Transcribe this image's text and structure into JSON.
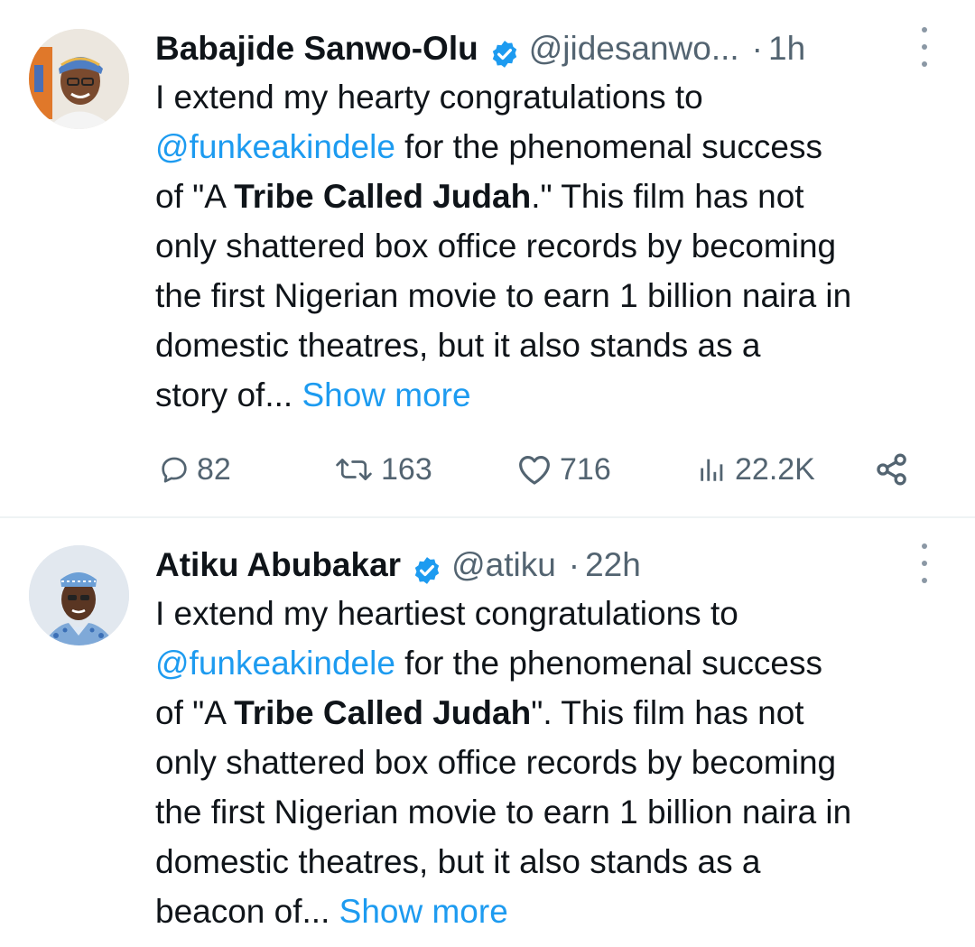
{
  "tweets": [
    {
      "author_name": "Babajide Sanwo-Olu",
      "handle": "@jidesanwo...",
      "separator": "·",
      "time": "1h",
      "lines": [
        [
          "I extend my hearty congratulations to"
        ],
        [
          "@funkeakindele",
          " for the phenomenal success"
        ],
        [
          "of \"A ",
          "Tribe Called Judah",
          ".\" This film has not"
        ],
        [
          "only shattered box office records by becoming"
        ],
        [
          "the first Nigerian movie to earn 1 billion naira in"
        ],
        [
          "domestic theatres, but it also stands as a"
        ],
        [
          "story of... ",
          "Show more"
        ]
      ],
      "stats": {
        "replies": "82",
        "retweets": "163",
        "likes": "716",
        "views": "22.2K"
      }
    },
    {
      "author_name": "Atiku Abubakar",
      "handle": "@atiku",
      "separator": "·",
      "time": "22h",
      "lines": [
        [
          "I extend my heartiest congratulations to"
        ],
        [
          "@funkeakindele",
          " for the phenomenal success"
        ],
        [
          "of \"A ",
          "Tribe Called Judah",
          "\". This film has not"
        ],
        [
          "only shattered box office records by becoming"
        ],
        [
          "the first Nigerian movie to earn 1 billion naira in"
        ],
        [
          "domestic theatres, but it also stands as a"
        ],
        [
          "beacon of... ",
          "Show more"
        ]
      ]
    }
  ],
  "icons": {
    "verified": "verified-badge-icon",
    "more": "more-options-icon",
    "reply": "reply-icon",
    "retweet": "retweet-icon",
    "like": "heart-icon",
    "views": "views-icon",
    "share": "share-icon"
  },
  "colors": {
    "link": "#1d9bf0",
    "secondary_text": "#536471",
    "primary_text": "#0f1419",
    "verified": "#1d9bf0",
    "divider": "#eff3f4"
  }
}
